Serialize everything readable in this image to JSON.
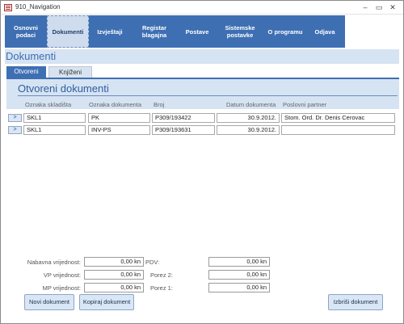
{
  "window": {
    "title": "910_Navigation",
    "minimize": "–",
    "restore": "▭",
    "close": "✕"
  },
  "nav": [
    {
      "label": "Osnovni podaci",
      "active": false
    },
    {
      "label": "Dokumenti",
      "active": true
    },
    {
      "label": "Izvještaji",
      "active": false
    },
    {
      "label": "Registar blagajna",
      "active": false
    },
    {
      "label": "Postave",
      "active": false
    },
    {
      "label": "Sistemske postavke",
      "active": false
    },
    {
      "label": "O programu",
      "active": false
    },
    {
      "label": "Odjava",
      "active": false
    }
  ],
  "page_title": "Dokumenti",
  "tabs": [
    {
      "label": "Otvoreni",
      "active": true
    },
    {
      "label": "Knjiženi",
      "active": false
    }
  ],
  "panel_title": "Otvoreni dokumenti",
  "columns": [
    "Oznaka skladišta",
    "Oznaka dokumenta",
    "Broj",
    "Datum dokumenta",
    "Poslovni partner"
  ],
  "row_button_label": ">",
  "rows": [
    {
      "skladiste": "SKL1",
      "dokument": "PK",
      "broj": "P309/193422",
      "datum": "30.9.2012.",
      "partner": "Stom. Ord. Dr. Denis Cerovac"
    },
    {
      "skladiste": "SKL1",
      "dokument": "INV-PS",
      "broj": "P309/193631",
      "datum": "30.9.2012.",
      "partner": ""
    }
  ],
  "summary": {
    "left": [
      {
        "label": "Nabavna vrijednost:",
        "value": "0,00 kn"
      },
      {
        "label": "VP vrijednost:",
        "value": "0,00 kn"
      },
      {
        "label": "MP vrijednost:",
        "value": "0,00 kn"
      }
    ],
    "right": [
      {
        "label": "PDV:",
        "value": "0,00 kn"
      },
      {
        "label": "Porez 2:",
        "value": "0,00 kn"
      },
      {
        "label": "Porez 1:",
        "value": "0,00 kn"
      }
    ]
  },
  "buttons": {
    "new": "Novi dokument",
    "copy": "Kopiraj dokument",
    "delete": "Izbriši dokument"
  },
  "colors": {
    "accent": "#3e6fb3",
    "header_bg": "#d6e3f3",
    "active_nav": "#cfdcee"
  }
}
